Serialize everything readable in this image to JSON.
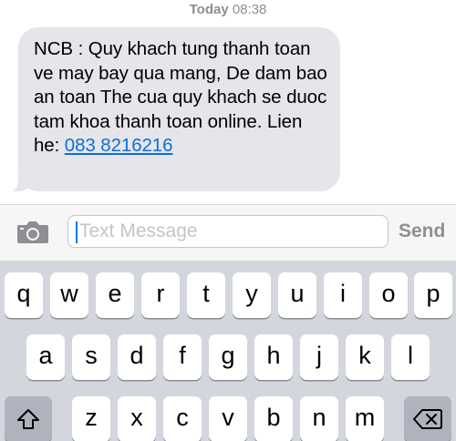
{
  "header": {
    "day": "Today",
    "time": "08:38"
  },
  "message": {
    "body": "NCB : Quy khach tung thanh toan ve may bay qua mang, De dam bao an toan The cua quy khach se duoc tam khoa thanh toan online. Lien he: ",
    "phone_link": "083 8216216"
  },
  "compose": {
    "placeholder": "Text Message",
    "send_label": "Send",
    "camera_icon": "camera-icon"
  },
  "keyboard": {
    "row1": [
      "q",
      "w",
      "e",
      "r",
      "t",
      "y",
      "u",
      "i",
      "o",
      "p"
    ],
    "row2": [
      "a",
      "s",
      "d",
      "f",
      "g",
      "h",
      "j",
      "k",
      "l"
    ],
    "row3": [
      "z",
      "x",
      "c",
      "v",
      "b",
      "n",
      "m"
    ],
    "shift_icon": "shift-icon",
    "delete_icon": "backspace-icon"
  },
  "colors": {
    "bubble": "#e5e5ea",
    "link": "#0b6fd9",
    "keyboard_bg": "#d3d6dc",
    "key": "#ffffff"
  }
}
